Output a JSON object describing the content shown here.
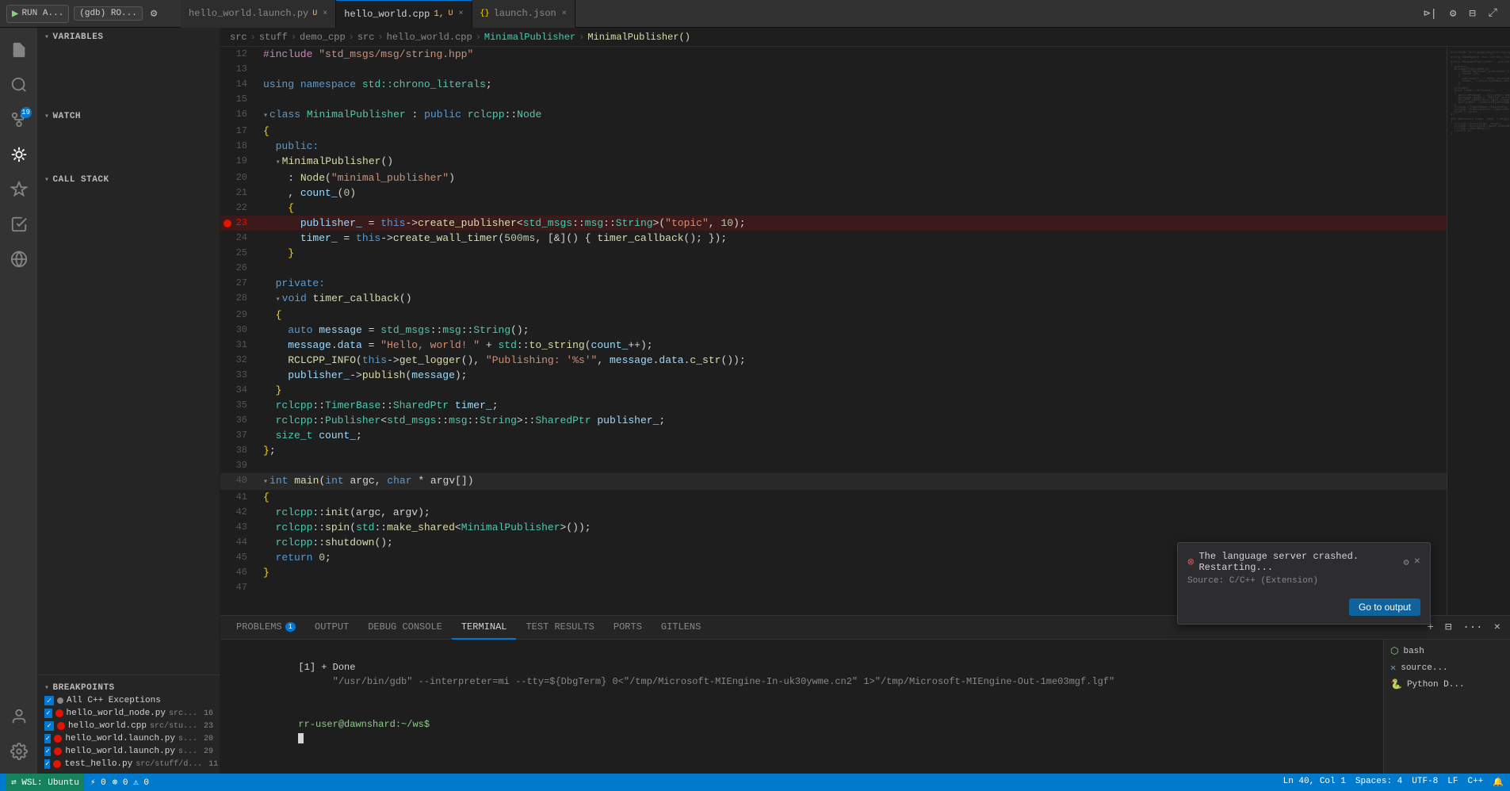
{
  "titlebar": {
    "run_label": "RUN A...",
    "debug_label": "(gdb) RO...",
    "tabs": [
      {
        "label": "hello_world.launch.py",
        "modified": true,
        "active": false,
        "lang": "py"
      },
      {
        "label": "hello_world.cpp",
        "modified": true,
        "active": true,
        "lang": "cpp"
      },
      {
        "label": "launch.json",
        "active": false,
        "lang": "json"
      }
    ]
  },
  "breadcrumb": {
    "items": [
      "src",
      "stuff",
      "demo_cpp",
      "src",
      "hello_world.cpp",
      "MinimalPublisher",
      "MinimalPublisher()"
    ]
  },
  "sidebar": {
    "variables_label": "VARIABLES",
    "watch_label": "WATCH",
    "call_stack_label": "CALL STACK",
    "breakpoints_label": "BREAKPOINTS",
    "breakpoints": [
      {
        "name": "All C++ Exceptions",
        "checked": true,
        "color": "#e51400",
        "path": "",
        "line": ""
      },
      {
        "name": "hello_world_node.py",
        "path": "src...",
        "line": "16",
        "checked": true,
        "color": "#e51400"
      },
      {
        "name": "hello_world.cpp",
        "path": "src/stu...",
        "line": "23",
        "checked": true,
        "color": "#e51400"
      },
      {
        "name": "hello_world.launch.py",
        "path": "s...",
        "line": "20",
        "checked": true,
        "color": "#e51400"
      },
      {
        "name": "hello_world.launch.py",
        "path": "s...",
        "line": "29",
        "checked": true,
        "color": "#e51400"
      },
      {
        "name": "test_hello.py",
        "path": "src/stuff/d...",
        "line": "11",
        "checked": true,
        "color": "#e51400"
      }
    ]
  },
  "editor": {
    "lines": [
      {
        "n": 12,
        "code": "#include \"std_msgs/msg/string.hpp\""
      },
      {
        "n": 13,
        "code": ""
      },
      {
        "n": 14,
        "code": "using namespace std::chrono_literals;"
      },
      {
        "n": 15,
        "code": ""
      },
      {
        "n": 16,
        "code": "class MinimalPublisher : public rclcpp::Node",
        "fold": true
      },
      {
        "n": 17,
        "code": "{"
      },
      {
        "n": 18,
        "code": "  public:"
      },
      {
        "n": 19,
        "code": "  MinimalPublisher()",
        "fold": true
      },
      {
        "n": 20,
        "code": "    : Node(\"minimal_publisher\")"
      },
      {
        "n": 21,
        "code": "    , count_(0)"
      },
      {
        "n": 22,
        "code": "    {"
      },
      {
        "n": 23,
        "code": "      publisher_ = this->create_publisher<std_msgs::msg::String>(\"topic\", 10);",
        "bp": true
      },
      {
        "n": 24,
        "code": "      timer_ = this->create_wall_timer(500ms, [&]() { timer_callback(); });"
      },
      {
        "n": 25,
        "code": "    }"
      },
      {
        "n": 26,
        "code": ""
      },
      {
        "n": 27,
        "code": "  private:"
      },
      {
        "n": 28,
        "code": "  void timer_callback()",
        "fold": true
      },
      {
        "n": 29,
        "code": "  {"
      },
      {
        "n": 30,
        "code": "    auto message = std_msgs::msg::String();"
      },
      {
        "n": 31,
        "code": "    message.data = \"Hello, world! \" + std::to_string(count_++);"
      },
      {
        "n": 32,
        "code": "    RCLCPP_INFO(this->get_logger(), \"Publishing: '%s'\", message.data.c_str());"
      },
      {
        "n": 33,
        "code": "    publisher_->publish(message);"
      },
      {
        "n": 34,
        "code": "  }"
      },
      {
        "n": 35,
        "code": "  rclcpp::TimerBase::SharedPtr timer_;"
      },
      {
        "n": 36,
        "code": "  rclcpp::Publisher<std_msgs::msg::String>::SharedPtr publisher_;"
      },
      {
        "n": 37,
        "code": "  size_t count_;"
      },
      {
        "n": 38,
        "code": "};"
      },
      {
        "n": 39,
        "code": ""
      },
      {
        "n": 40,
        "code": "int main(int argc, char * argv[])",
        "fold": true
      },
      {
        "n": 41,
        "code": "{"
      },
      {
        "n": 42,
        "code": "  rclcpp::init(argc, argv);"
      },
      {
        "n": 43,
        "code": "  rclcpp::spin(std::make_shared<MinimalPublisher>());"
      },
      {
        "n": 44,
        "code": "  rclcpp::shutdown();"
      },
      {
        "n": 45,
        "code": "  return 0;"
      },
      {
        "n": 46,
        "code": "}"
      },
      {
        "n": 47,
        "code": ""
      }
    ]
  },
  "bottom_panel": {
    "tabs": [
      {
        "label": "PROBLEMS",
        "badge": "1",
        "active": false
      },
      {
        "label": "OUTPUT",
        "active": false
      },
      {
        "label": "DEBUG CONSOLE",
        "active": false
      },
      {
        "label": "TERMINAL",
        "active": true
      },
      {
        "label": "TEST RESULTS",
        "active": false
      },
      {
        "label": "PORTS",
        "active": false
      },
      {
        "label": "GITLENS",
        "active": false
      }
    ],
    "terminal": {
      "line1": "[1] + Done",
      "line1_cmd": "      \"/usr/bin/gdb\" --interpreter=mi --tty=${DbgTerm} 0<\"/tmp/Microsoft-MIEngine-In-uk30ywme.cn2\" 1>\"/tmp/Microsoft-MIEngine-Out-1me03mgf.lgf\"",
      "prompt": "rr-user@dawnshard:~/ws$",
      "cursor": true
    },
    "terminal_right": [
      {
        "icon": "bash",
        "label": "bash"
      },
      {
        "icon": "source",
        "label": "source..."
      },
      {
        "icon": "python",
        "label": "Python D..."
      }
    ]
  },
  "notification": {
    "title": "The language server crashed. Restarting...",
    "source": "Source: C/C++ (Extension)",
    "btn_label": "Go to output",
    "visible": true
  },
  "status_bar": {
    "left": [
      "⚡ 0",
      "⊗ 0"
    ],
    "right": [
      "Ln 40, Col 1",
      "Spaces: 4",
      "UTF-8",
      "LF",
      "C++"
    ]
  }
}
